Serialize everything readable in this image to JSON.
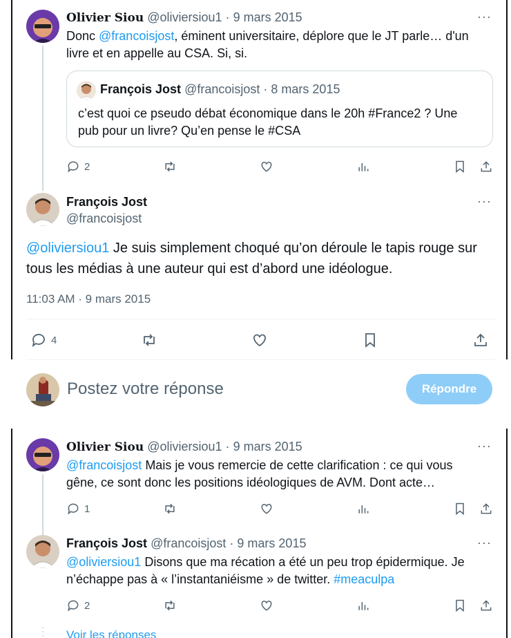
{
  "tweets": {
    "t1": {
      "name": "Olivier Siou",
      "handle": "@oliviersiou1",
      "sep": "·",
      "date": "9 mars 2015",
      "text_pre": "Donc ",
      "mention": "@francoisjost",
      "text_post": ", éminent universitaire, déplore que le JT parle… d'un",
      "text_line2": "livre et en appelle au CSA. Si, si.",
      "quote": {
        "name": "François Jost",
        "handle": "@francoisjost",
        "date": "8 mars 2015",
        "text_line1": "c’est quoi ce pseudo débat économique dans le 20h #France2 ? Une",
        "text_line2": "pub pour un livre? Qu’en pense le #CSA"
      },
      "replies": "2"
    },
    "main": {
      "name": "François Jost",
      "handle": "@francoisjost",
      "mention": "@oliviersiou1",
      "text_a": " Je suis simplement choqué qu’on déroule le tapis rouge sur",
      "text_b": "tous les médias à une auteur qui est d’abord une idéologue.",
      "timestamp": "11:03 AM · 9 mars 2015",
      "replies": "4"
    },
    "t3": {
      "name": "Olivier Siou",
      "handle": "@oliviersiou1",
      "sep": "·",
      "date": "9 mars 2015",
      "mention": "@francoisjost",
      "text_a": " Mais je vous remercie de cette clarification : ce qui vous",
      "text_b": "gêne, ce sont  donc les positions idéologiques de AVM. Dont acte…",
      "replies": "1"
    },
    "t4": {
      "name": "François Jost",
      "handle": "@francoisjost",
      "sep": "·",
      "date": "9 mars 2015",
      "mention": "@oliviersiou1",
      "text_a": "  Disons que ma récation a été un peu trop épidermique. Je",
      "text_b": "n’échappe pas à « l’instantaniéisme » de twitter. ",
      "hashtag": "#meaculpa",
      "replies": "2"
    }
  },
  "more_label": "···",
  "reply_box": {
    "placeholder": "Postez votre réponse",
    "button": "Répondre"
  },
  "see_replies": "Voir les réponses",
  "colors": {
    "link": "#1d9bf0",
    "muted": "#536471",
    "button_disabled": "#8ecdf8"
  },
  "icons": [
    "reply-icon",
    "retweet-icon",
    "like-icon",
    "views-icon",
    "bookmark-icon",
    "share-icon"
  ]
}
